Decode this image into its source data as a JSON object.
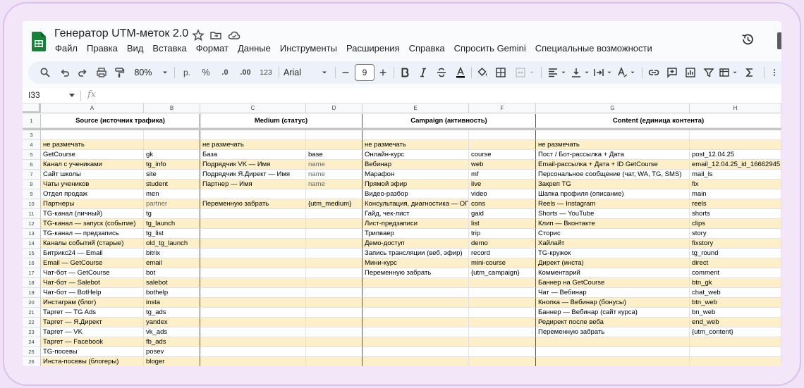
{
  "doc": {
    "title": "Генератор UTM-меток 2.0"
  },
  "menu": [
    "Файл",
    "Правка",
    "Вид",
    "Вставка",
    "Формат",
    "Данные",
    "Инструменты",
    "Расширения",
    "Справка",
    "Спросить Gemini",
    "Специальные возможности"
  ],
  "toolbar": {
    "zoom": "80%",
    "currency": "р.",
    "percent": "%",
    "dec_less": ".0",
    "dec_more": ".00",
    "format123": "123",
    "font": "Arial",
    "font_size": "9"
  },
  "formula_bar": {
    "cell_ref": "I33",
    "fx": "fx"
  },
  "columns": [
    "A",
    "B",
    "C",
    "D",
    "E",
    "F",
    "G",
    "H"
  ],
  "headers": {
    "source": "Source (источник трафика)",
    "medium": "Medium (статус)",
    "campaign": "Campaign (активность)",
    "content": "Content (единица контента)"
  },
  "rows": [
    {
      "n": "4",
      "a": "не размечать",
      "b": "",
      "c": "не размечать",
      "d": "",
      "e": "не размечать",
      "f": "",
      "g": "не размечать",
      "h": "",
      "hl": true
    },
    {
      "n": "5",
      "a": "GetCourse",
      "b": "gk",
      "c": "База",
      "d": "base",
      "e": "Онлайн-курс",
      "f": "course",
      "g": "Пост / Бот-рассылка + Дата",
      "h": "post_12.04.25",
      "hl": false
    },
    {
      "n": "6",
      "a": "Канал с учениками",
      "b": "tg_info",
      "c": "Подрядчик VK — Имя",
      "d": "name",
      "e": "Вебинар",
      "f": "web",
      "g": "Email-рассылка + Дата + ID GetCourse",
      "h": "email_12.04.25_id_16662945",
      "hl": true
    },
    {
      "n": "7",
      "a": "Сайт школы",
      "b": "site",
      "c": "Подрядчик Я.Директ — Имя",
      "d": "name",
      "e": "Марафон",
      "f": "mf",
      "g": "Персональное сообщение (чат, WA, TG, SMS)",
      "h": "mail_ls",
      "hl": false
    },
    {
      "n": "8",
      "a": "Чаты учеников",
      "b": "student",
      "c": "Партнер — Имя",
      "d": "name",
      "e": "Прямой эфир",
      "f": "live",
      "g": "Закреп TG",
      "h": "fix",
      "hl": true
    },
    {
      "n": "9",
      "a": "Отдел продаж",
      "b": "men",
      "c": "",
      "d": "",
      "e": "Видео-разбор",
      "f": "video",
      "g": "Шапка профиля (описание)",
      "h": "main",
      "hl": false
    },
    {
      "n": "10",
      "a": "Партнеры",
      "b": "partner",
      "c": "Переменную забрать",
      "d": "{utm_medium}",
      "e": "Консультация, диагностика — ОП",
      "f": "cons",
      "g": "Reels — Instagram",
      "h": "reels",
      "hl": true
    },
    {
      "n": "11",
      "a": "TG-канал (личный)",
      "b": "tg",
      "c": "",
      "d": "",
      "e": "Гайд, чек-лист",
      "f": "gaid",
      "g": "Shorts — YouTube",
      "h": "shorts",
      "hl": false
    },
    {
      "n": "12",
      "a": "TG-канал — запуск (событие)",
      "b": "tg_launch",
      "c": "",
      "d": "",
      "e": "Лист-предзаписи",
      "f": "list",
      "g": "Клип — Вконтакте",
      "h": "clips",
      "hl": true
    },
    {
      "n": "13",
      "a": "TG-канал — предзапись",
      "b": "tg_list",
      "c": "",
      "d": "",
      "e": "Трипваер",
      "f": "trip",
      "g": "Сторис",
      "h": "story",
      "hl": false
    },
    {
      "n": "14",
      "a": "Каналы событий (старые)",
      "b": "old_tg_launch",
      "c": "",
      "d": "",
      "e": "Демо-доступ",
      "f": "demo",
      "g": "Хайлайт",
      "h": "fixstory",
      "hl": true
    },
    {
      "n": "15",
      "a": "Битрикс24 — Email",
      "b": "bitrix",
      "c": "",
      "d": "",
      "e": "Запись трансляции (веб, эфир)",
      "f": "record",
      "g": "TG-кружок",
      "h": "tg_round",
      "hl": false
    },
    {
      "n": "16",
      "a": "Email — GetCourse",
      "b": "email",
      "c": "",
      "d": "",
      "e": "Мини-курс",
      "f": "mini-course",
      "g": "Директ (инста)",
      "h": "direct",
      "hl": true
    },
    {
      "n": "17",
      "a": "Чат-бот — GetCourse",
      "b": "bot",
      "c": "",
      "d": "",
      "e": "Переменную забрать",
      "f": "{utm_campaign}",
      "g": "Комментарий",
      "h": "comment",
      "hl": false
    },
    {
      "n": "18",
      "a": "Чат-бот — Salebot",
      "b": "salebot",
      "c": "",
      "d": "",
      "e": "",
      "f": "",
      "g": "Баннер на GetCourse",
      "h": "btn_gk",
      "hl": true
    },
    {
      "n": "19",
      "a": "Чат-бот — BotHelp",
      "b": "bothelp",
      "c": "",
      "d": "",
      "e": "",
      "f": "",
      "g": "Чат — Вебинар",
      "h": "chat_web",
      "hl": false
    },
    {
      "n": "20",
      "a": "Инстаграм (блог)",
      "b": "insta",
      "c": "",
      "d": "",
      "e": "",
      "f": "",
      "g": "Кнопка — Вебинар (бонусы)",
      "h": "btn_web",
      "hl": true
    },
    {
      "n": "21",
      "a": "Таргет — TG Ads",
      "b": "tg_ads",
      "c": "",
      "d": "",
      "e": "",
      "f": "",
      "g": "Баннер — Вебинар (сайт курса)",
      "h": "bn_web",
      "hl": false
    },
    {
      "n": "22",
      "a": "Таргет — Я.Директ",
      "b": "yandex",
      "c": "",
      "d": "",
      "e": "",
      "f": "",
      "g": "Редирект после веба",
      "h": "end_web",
      "hl": true
    },
    {
      "n": "23",
      "a": "Таргет — VK",
      "b": "vk_ads",
      "c": "",
      "d": "",
      "e": "",
      "f": "",
      "g": "Переменную забрать",
      "h": "{utm_content}",
      "hl": false
    },
    {
      "n": "24",
      "a": "Таргет — Facebook",
      "b": "fb_ads",
      "c": "",
      "d": "",
      "e": "",
      "f": "",
      "g": "",
      "h": "",
      "hl": true
    },
    {
      "n": "25",
      "a": "TG-посевы",
      "b": "posev",
      "c": "",
      "d": "",
      "e": "",
      "f": "",
      "g": "",
      "h": "",
      "hl": false
    },
    {
      "n": "26",
      "a": "Инста-посевы (блогеры)",
      "b": "bloger",
      "c": "",
      "d": "",
      "e": "",
      "f": "",
      "g": "",
      "h": "",
      "hl": true
    }
  ]
}
